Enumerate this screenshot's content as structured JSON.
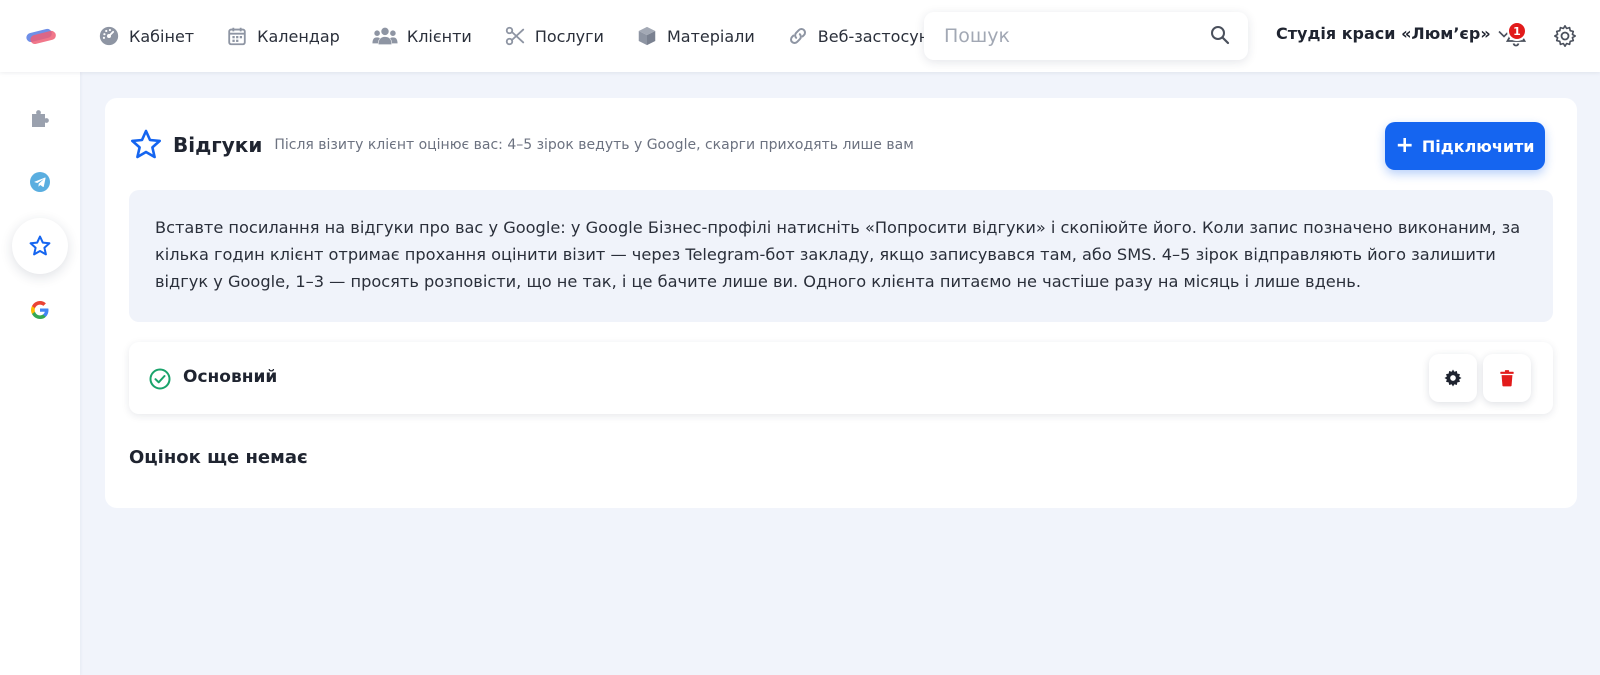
{
  "nav": {
    "items": [
      {
        "label": "Кабінет",
        "icon": "dashboard-icon"
      },
      {
        "label": "Календар",
        "icon": "calendar-icon"
      },
      {
        "label": "Клієнти",
        "icon": "users-icon"
      },
      {
        "label": "Послуги",
        "icon": "scissors-icon"
      },
      {
        "label": "Матеріали",
        "icon": "box-icon"
      },
      {
        "label": "Веб-застосунок",
        "icon": "link-icon"
      }
    ]
  },
  "search": {
    "placeholder": "Пошук"
  },
  "studio": {
    "name": "Студія краси «Люм’єр»"
  },
  "notifications": {
    "count": "1"
  },
  "colors": {
    "accent": "#1565f0",
    "danger": "#e21b1b",
    "success": "#19a36b",
    "page_bg": "#f1f4fb"
  },
  "sidebar": {
    "items": [
      {
        "icon": "puzzle-icon",
        "active": false
      },
      {
        "icon": "telegram-icon",
        "active": false
      },
      {
        "icon": "star-icon",
        "active": true
      },
      {
        "icon": "google-icon",
        "active": false
      }
    ]
  },
  "reviews": {
    "title": "Відгуки",
    "subtitle": "Після візиту клієнт оцінює вас: 4–5 зірок ведуть у Google, скарги приходять лише вам",
    "connect_label": "Підключити",
    "info": "Вставте посилання на відгуки про вас у Google: у Google Бізнес-профілі натисніть «Попросити відгуки» і скопіюйте його. Коли запис позначено виконаним, за кілька годин клієнт отримає прохання оцінити візит — через Telegram-бот закладу, якщо записувався там, або SMS. 4–5 зірок відправляють його залишити відгук у Google, 1–3 — просять розповісти, що не так, і це бачите лише ви. Одного клієнта питаємо не частіше разу на місяць і лише вдень.",
    "item_name": "Основний",
    "empty_text": "Оцінок ще немає"
  }
}
